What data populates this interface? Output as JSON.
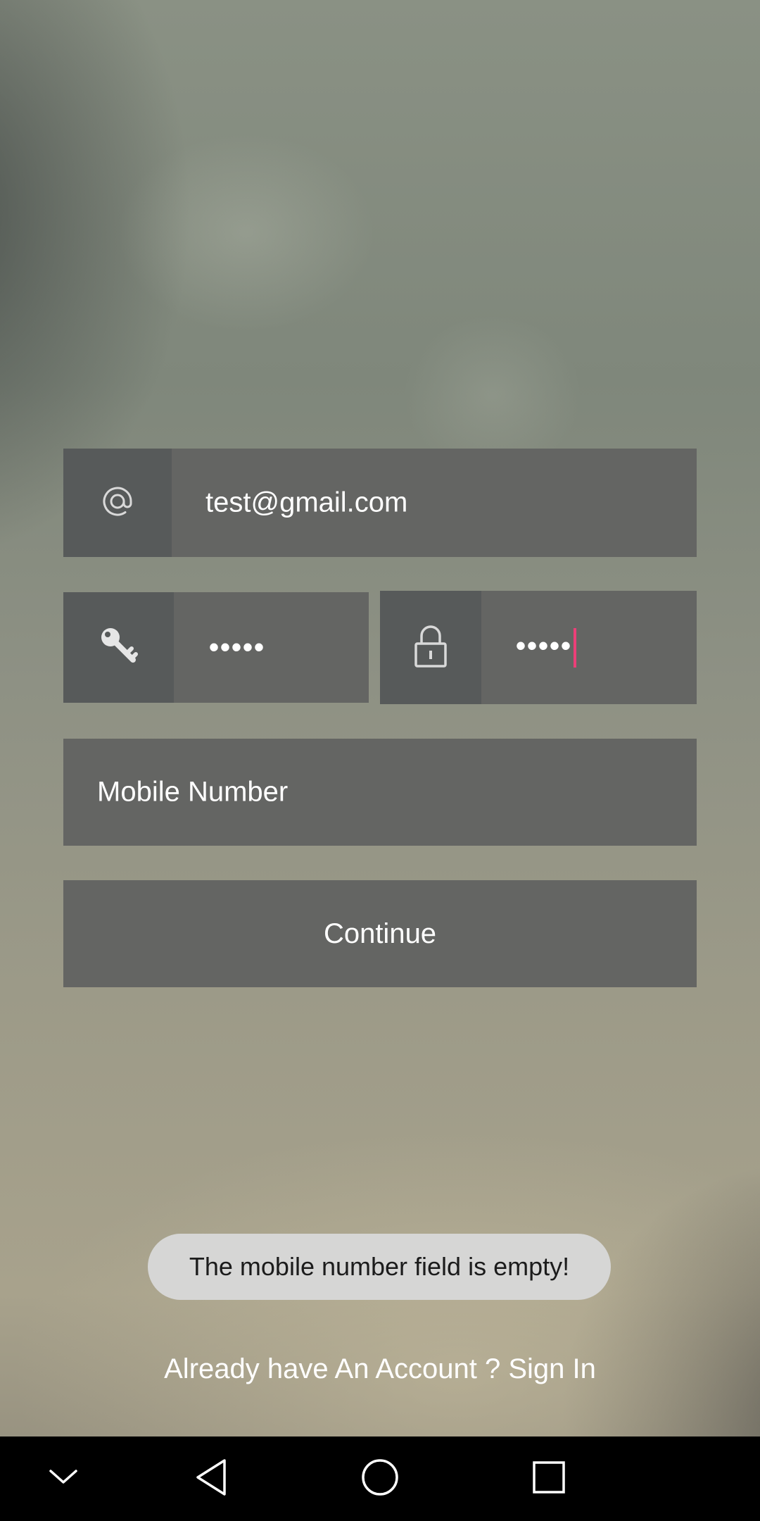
{
  "form": {
    "email": {
      "icon": "at-sign-icon",
      "value": "test@gmail.com"
    },
    "password": {
      "icon": "key-icon",
      "masked_value": "•••••"
    },
    "confirm_password": {
      "icon": "lock-icon",
      "masked_value": "•••••",
      "focused": true
    },
    "mobile": {
      "placeholder": "Mobile Number",
      "value": ""
    },
    "continue_label": "Continue"
  },
  "toast": {
    "message": "The mobile number field is empty!"
  },
  "footer": {
    "signin_text": "Already have An Account ? Sign In"
  },
  "nav_bar": {
    "buttons": [
      "hide-keyboard-icon",
      "back-icon",
      "home-icon",
      "recents-icon"
    ]
  },
  "colors": {
    "field_background": "#646563",
    "icon_box_background": "#575a5a",
    "cursor": "#ec3f78",
    "toast_background": "#d6d6d5",
    "nav_bar": "#000000"
  }
}
